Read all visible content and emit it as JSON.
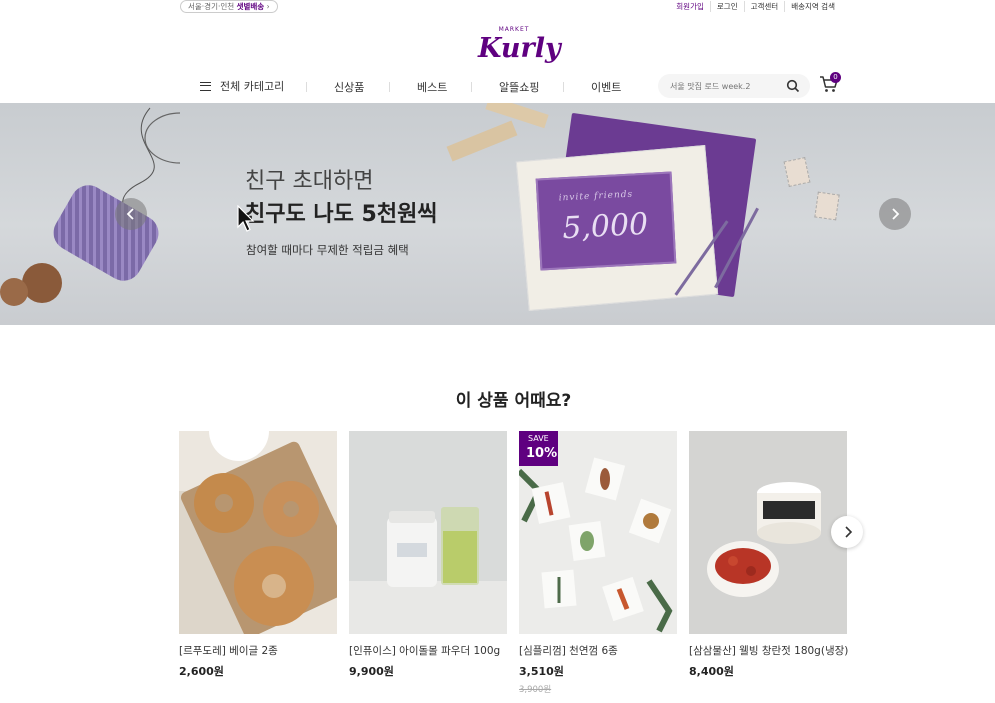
{
  "topbar": {
    "delivery_region": "서울·경기·인천",
    "delivery_type": "샛별배송",
    "links": [
      "회원가입",
      "로그인",
      "고객센터",
      "배송지역 검색"
    ]
  },
  "logo": {
    "small": "MARKET",
    "script": "Kurly"
  },
  "gnb": {
    "category": "전체 카테고리",
    "items": [
      "신상품",
      "베스트",
      "알뜰쇼핑",
      "이벤트"
    ],
    "search_placeholder": "서울 맛집 로드 week.2",
    "cart_count": "0"
  },
  "banner": {
    "title1": "친구 초대하면",
    "title2": "친구도 나도 5천원씩",
    "subtitle": "참여할 때마다 무제한 적립금 혜택",
    "card_line1": "invite friends",
    "card_line2": "5,000"
  },
  "section": {
    "title": "이 상품 어때요?",
    "products": [
      {
        "name": "[르푸도레] 베이글 2종",
        "price": "2,600원"
      },
      {
        "name": "[인퓨이스] 아이돌몰 파우더 100g",
        "price": "9,900원"
      },
      {
        "name": "[심플리껌] 천연껌 6종",
        "price": "3,510원",
        "original_price": "3,900원",
        "badge_label": "SAVE",
        "badge_percent": "10%"
      },
      {
        "name": "[삼삼물산] 웰빙 창란젓 180g(냉장)",
        "price": "8,400원"
      }
    ]
  },
  "colors": {
    "brand": "#5f0080"
  }
}
